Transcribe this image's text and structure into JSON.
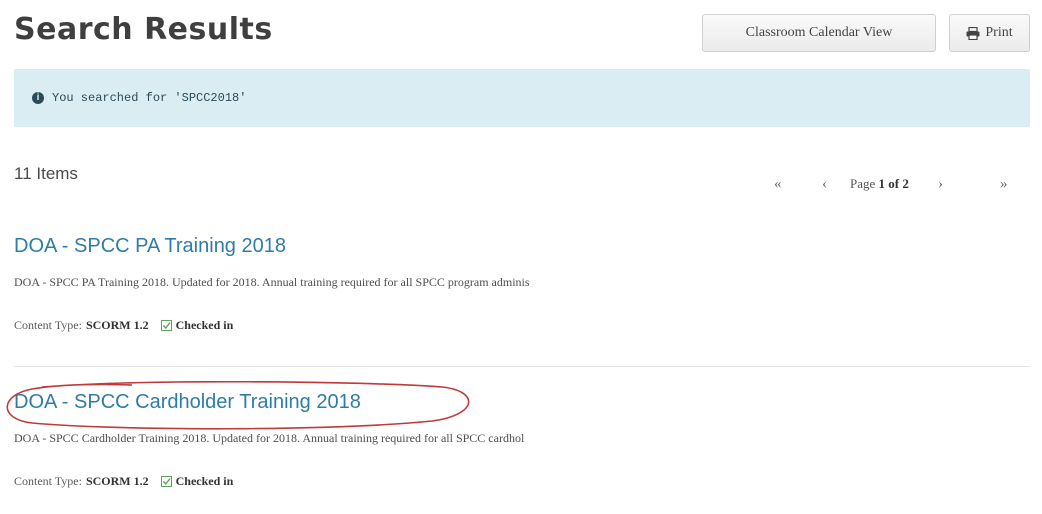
{
  "header": {
    "title": "Search Results",
    "calendar_button": "Classroom Calendar View",
    "print_button": "Print"
  },
  "alert": {
    "icon": "info-circle-icon",
    "text": "You searched for 'SPCC2018'"
  },
  "results_count": "11 Items",
  "pagination": {
    "first": "«",
    "prev": "‹",
    "prefix": "Page ",
    "current": "1 of 2",
    "next": "›",
    "last": "»"
  },
  "results": [
    {
      "title": "DOA - SPCC PA Training 2018",
      "description": "DOA - SPCC PA Training 2018. Updated for 2018. Annual training required for all SPCC program adminis",
      "content_type_label": "Content Type:",
      "content_type": "SCORM 1.2",
      "status": "Checked in"
    },
    {
      "title": "DOA - SPCC Cardholder Training 2018",
      "description": "DOA - SPCC Cardholder Training 2018. Updated for 2018. Annual training required for all SPCC cardhol",
      "content_type_label": "Content Type:",
      "content_type": "SCORM 1.2",
      "status": "Checked in"
    }
  ],
  "colors": {
    "link": "#2e7ca8",
    "alert_bg": "#d9edf2",
    "annotation": "#c0393b",
    "check": "#5ca65c"
  }
}
